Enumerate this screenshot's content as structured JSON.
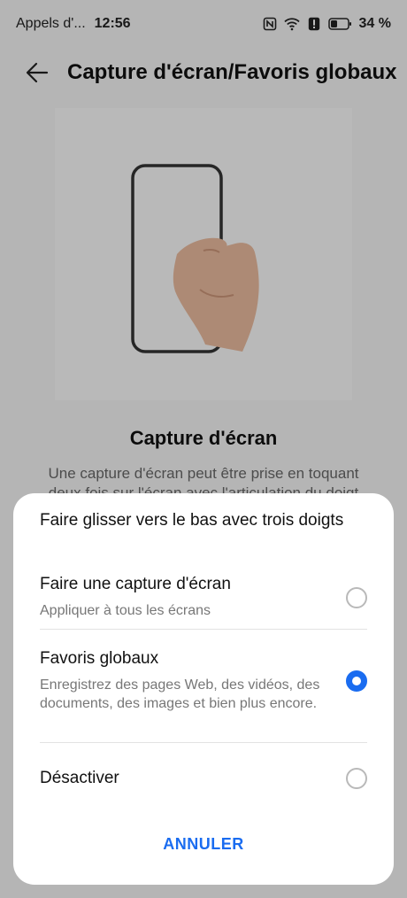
{
  "status_bar": {
    "carrier": "Appels d'...",
    "time": "12:56",
    "battery": "34 %",
    "icons": [
      "nfc-icon",
      "wifi-icon",
      "alert-icon",
      "battery-icon"
    ]
  },
  "app_bar": {
    "back_icon": "arrow-left-icon",
    "title": "Capture d'écran/Favoris globaux"
  },
  "illustration": {
    "icon": "phone-knuckle-illustration"
  },
  "section": {
    "title": "Capture d'écran",
    "description": "Une capture d'écran peut être prise en toquant deux fois sur l'écran avec l'articulation du doigt"
  },
  "sheet": {
    "title": "Faire glisser vers le bas avec trois doigts",
    "options": [
      {
        "label": "Faire une capture d'écran",
        "description": "Appliquer à tous les écrans",
        "selected": false
      },
      {
        "label": "Favoris globaux",
        "description": "Enregistrez des pages Web, des vidéos, des documents, des images et bien plus encore.",
        "selected": true
      },
      {
        "label": "Désactiver",
        "description": "",
        "selected": false
      }
    ],
    "cancel_label": "ANNULER"
  },
  "colors": {
    "accent": "#1a6cf0",
    "overlay": "rgba(0,0,0,0.25)"
  }
}
